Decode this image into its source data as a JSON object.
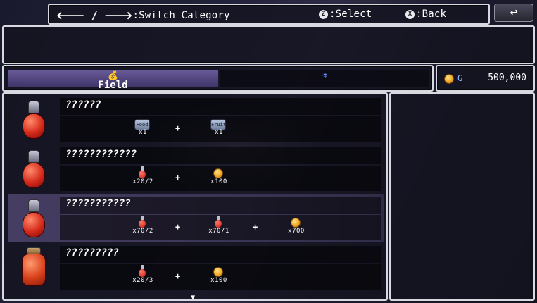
{
  "help": {
    "switch_label": ":Switch Category",
    "arrows": "🡐 / 🡒",
    "select_key": "Z",
    "select_label": ":Select",
    "back_key": "X",
    "back_label": ":Back"
  },
  "back_button": {
    "icon": "return-arrow-icon",
    "glyph": "↩"
  },
  "categories": [
    {
      "label": "Field",
      "icon": "money-bag-icon",
      "selected": true
    },
    {
      "label": "",
      "icon": "blue-flask-icon",
      "selected": false
    }
  ],
  "gold": {
    "unit": "G",
    "amount": "500,000"
  },
  "recipes": [
    {
      "name": "??????",
      "icon": "red-potion-icon",
      "ingredients": [
        {
          "icon": "food-can-icon",
          "tag": "Food",
          "qty": "x1"
        },
        {
          "icon": "fruit-can-icon",
          "tag": "Fruit",
          "qty": "x1"
        }
      ]
    },
    {
      "name": "????????????",
      "icon": "red-potion-icon",
      "ingredients": [
        {
          "icon": "mini-potion-icon",
          "qty": "x20/2"
        },
        {
          "icon": "gold-coin-icon",
          "qty": "x100"
        }
      ]
    },
    {
      "name": "???????????",
      "icon": "red-potion-icon",
      "selected": true,
      "ingredients": [
        {
          "icon": "mini-potion-icon",
          "qty": "x70/2"
        },
        {
          "icon": "mini-potion-icon",
          "qty": "x70/1"
        },
        {
          "icon": "gold-coin-icon",
          "qty": "x700"
        }
      ]
    },
    {
      "name": "?????????",
      "icon": "red-jar-icon",
      "ingredients": [
        {
          "icon": "mini-potion-icon",
          "qty": "x20/3"
        },
        {
          "icon": "gold-coin-icon",
          "qty": "x100"
        }
      ]
    }
  ],
  "plus_sign": "+",
  "scroll_indicator": "▼"
}
